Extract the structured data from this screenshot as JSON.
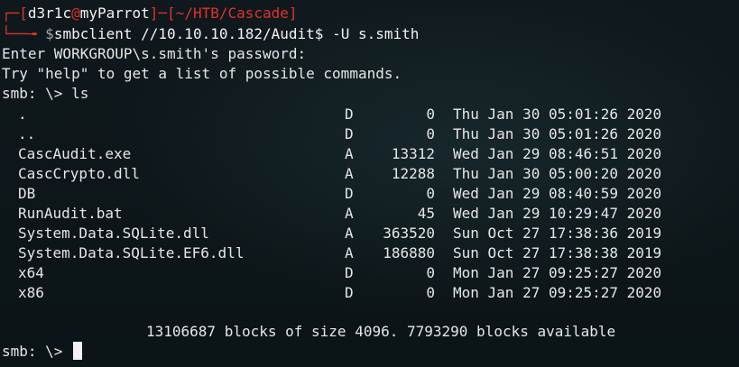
{
  "prompt": {
    "open_bracket": "┌─[",
    "user": "d3r1c",
    "at": "@",
    "host": "myParrot",
    "sep": "]─[",
    "cwd": "~/HTB/Cascade",
    "close_bracket": "]",
    "corner": "└──╼",
    "dollar": "$",
    "command": "smbclient //10.10.10.182/Audit$ -U s.smith"
  },
  "output": {
    "password_prompt": "Enter WORKGROUP\\s.smith's password:",
    "help_hint": "Try \"help\" to get a list of possible commands.",
    "smb_prompt_ls": "smb: \\> ls",
    "listing": [
      {
        "name": ".",
        "type": "D",
        "size": "0",
        "date": "Thu Jan 30 05:01:26 2020"
      },
      {
        "name": "..",
        "type": "D",
        "size": "0",
        "date": "Thu Jan 30 05:01:26 2020"
      },
      {
        "name": "CascAudit.exe",
        "type": "A",
        "size": "13312",
        "date": "Wed Jan 29 08:46:51 2020"
      },
      {
        "name": "CascCrypto.dll",
        "type": "A",
        "size": "12288",
        "date": "Thu Jan 30 05:00:20 2020"
      },
      {
        "name": "DB",
        "type": "D",
        "size": "0",
        "date": "Wed Jan 29 08:40:59 2020"
      },
      {
        "name": "RunAudit.bat",
        "type": "A",
        "size": "45",
        "date": "Wed Jan 29 10:29:47 2020"
      },
      {
        "name": "System.Data.SQLite.dll",
        "type": "A",
        "size": "363520",
        "date": "Sun Oct 27 17:38:36 2019"
      },
      {
        "name": "System.Data.SQLite.EF6.dll",
        "type": "A",
        "size": "186880",
        "date": "Sun Oct 27 17:38:38 2019"
      },
      {
        "name": "x64",
        "type": "D",
        "size": "0",
        "date": "Mon Jan 27 09:25:27 2020"
      },
      {
        "name": "x86",
        "type": "D",
        "size": "0",
        "date": "Mon Jan 27 09:25:27 2020"
      }
    ],
    "summary": "13106687 blocks of size 4096. 7793290 blocks available",
    "final_prompt": "smb: \\> "
  },
  "colors": {
    "background": "#0e171b",
    "prompt_red": "#e0332b",
    "text": "#e6e6e6"
  }
}
